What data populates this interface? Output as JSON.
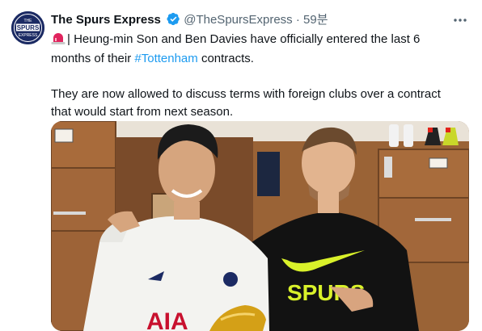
{
  "tweet": {
    "account_name": "The Spurs Express",
    "handle": "@TheSpursExpress",
    "separator": "·",
    "time": "59분",
    "avatar_text_top": "THE",
    "avatar_text_mid": "SPURS",
    "avatar_text_bottom": "EXPRESS",
    "text_line1_prefix": "| Heung-min Son and Ben Davies have officially entered the last 6 months of their ",
    "hashtag": "#Tottenham",
    "text_line1_suffix": " contracts.",
    "text_para2": "They are now allowed to discuss terms with foreign clubs over a contract that would start from next season.",
    "photo": {
      "left_shirt_text": "AIA",
      "right_shirt_text": "SPURS"
    }
  },
  "icons": {
    "verified": "verified-badge-icon",
    "more": "more-options-icon",
    "siren": "siren-emoji-icon"
  },
  "colors": {
    "link": "#1d9bf0",
    "muted": "#536471",
    "verified": "#1d9bf0",
    "avatar_bg": "#1b2a63"
  }
}
